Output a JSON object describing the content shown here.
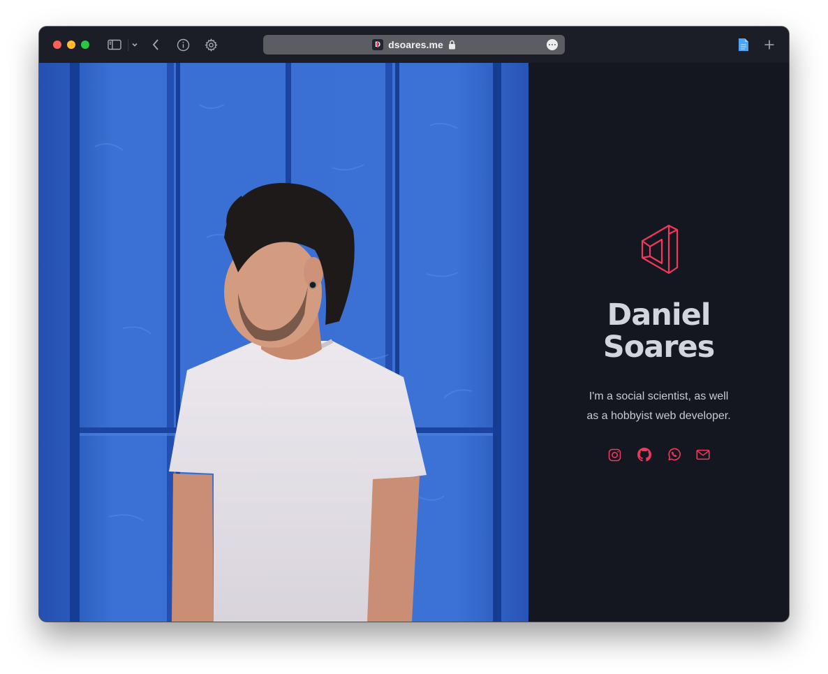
{
  "browser": {
    "url_domain": "dsoares.me",
    "favicon_letter": "D"
  },
  "profile": {
    "name_line1": "Daniel",
    "name_line2": "Soares",
    "tagline_line1": "I'm a social scientist, as well",
    "tagline_line2": "as a hobbyist web developer."
  },
  "socials": [
    "instagram-icon",
    "github-icon",
    "whatsapp-icon",
    "mail-icon"
  ],
  "colors": {
    "accent": "#f2385a",
    "panel_background": "#141720",
    "heading": "#d3d5dc",
    "photo_wall": "#3569cf"
  }
}
